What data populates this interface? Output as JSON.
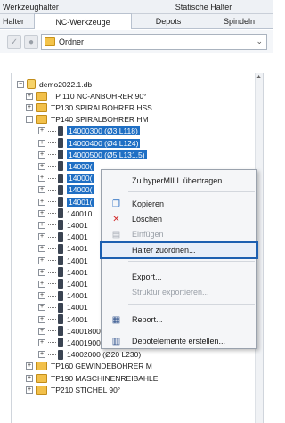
{
  "tabs": {
    "top": [
      "Werkzeughalter",
      "Statische Halter"
    ],
    "bottom": [
      "Halter",
      "NC-Werkzeuge",
      "Depots",
      "Spindeln"
    ]
  },
  "toolbar": {
    "combo_value": "Ordner"
  },
  "tree": {
    "root": "demo2022.1.db",
    "folders": [
      "TP 110 NC-ANBOHRER 90°",
      "TP130 SPIRALBOHRER HSS",
      "TP140 SPIRALBOHRER HM"
    ],
    "items": [
      "14000300  (Ø3 L118)",
      "14000400  (Ø4 L124)",
      "14000500  (Ø5 L131.5)",
      "14000(",
      "14000(",
      "14000(",
      "14001(",
      "140010",
      "14001",
      "14001",
      "14001",
      "14001",
      "14001",
      "14001",
      "14001",
      "14001",
      "14001",
      "14001800  (Ø18 L199.5)",
      "14001900  (Ø19 L228)",
      "14002000  (Ø20 L230)"
    ],
    "folders_after": [
      "TP160 GEWINDEBOHRER M",
      "TP190 MASCHINENREIBAHLE",
      "TP210 STICHEL 90°"
    ]
  },
  "context_menu": {
    "items": [
      {
        "label": "Zu hyperMILL übertragen",
        "icon": "",
        "disabled": false
      },
      {
        "label": "Kopieren",
        "icon": "copy-icon",
        "disabled": false
      },
      {
        "label": "Löschen",
        "icon": "delete-icon",
        "disabled": false
      },
      {
        "label": "Einfügen",
        "icon": "paste-icon",
        "disabled": true
      },
      {
        "label": "Halter zuordnen...",
        "icon": "",
        "disabled": false,
        "highlighted": true
      },
      {
        "label": "Export...",
        "icon": "",
        "disabled": false
      },
      {
        "label": "Struktur exportieren...",
        "icon": "",
        "disabled": true
      },
      {
        "label": "Report...",
        "icon": "report-icon",
        "disabled": false
      },
      {
        "label": "Depotelemente erstellen...",
        "icon": "depot-icon",
        "disabled": false
      }
    ]
  },
  "colors": {
    "selection": "#1f6fc4",
    "highlight_border": "#1c5fb0",
    "folder": "#f2c04a"
  }
}
